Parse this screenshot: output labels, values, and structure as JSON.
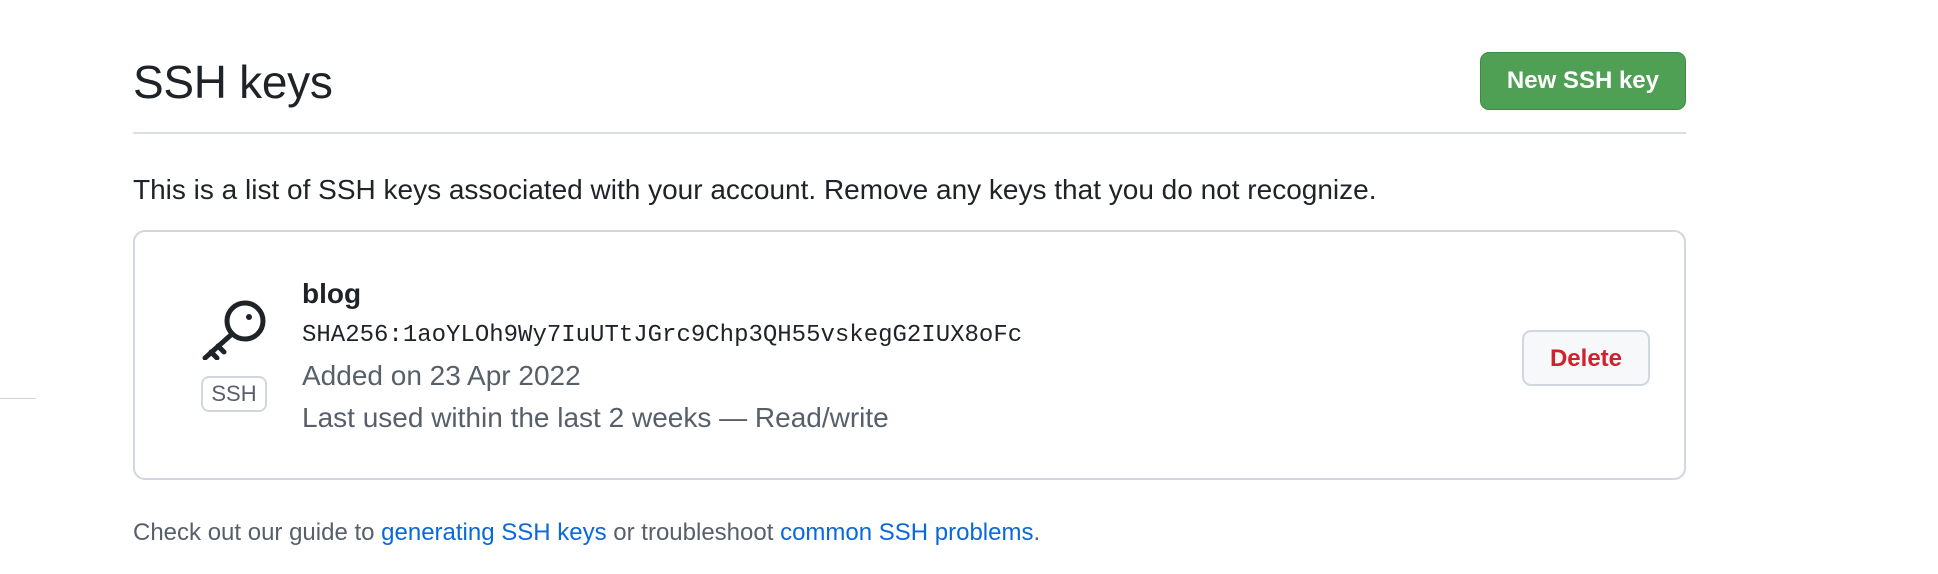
{
  "header": {
    "title": "SSH keys",
    "new_key_label": "New SSH key"
  },
  "description": "This is a list of SSH keys associated with your account. Remove any keys that you do not recognize.",
  "keys": [
    {
      "title": "blog",
      "fingerprint": "SHA256:1aoYLOh9Wy7IuUTtJGrc9Chp3QH55vskegG2IUX8oFc",
      "added": "Added on 23 Apr 2022",
      "last_used": "Last used within the last 2 weeks — Read/write",
      "type_label": "SSH",
      "icon": "key-icon",
      "delete_label": "Delete"
    }
  ],
  "footer": {
    "prefix": "Check out our guide to ",
    "link_generating": "generating SSH keys",
    "middle": " or troubleshoot ",
    "link_problems": "common SSH problems",
    "suffix": "."
  },
  "colors": {
    "primary_button": "#4f9f55",
    "danger_text": "#cf222e",
    "link": "#0969da",
    "muted_text": "#57606a",
    "border": "#d0d7de"
  }
}
